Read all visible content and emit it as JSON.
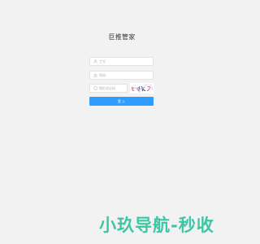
{
  "title": "巨推管家",
  "form": {
    "username": {
      "icon": "user-icon",
      "placeholder": "工号"
    },
    "password": {
      "icon": "lock-icon",
      "placeholder": "密码"
    },
    "captcha": {
      "icon": "shield-icon",
      "placeholder": "图形验证码"
    },
    "login_label": "登 入"
  },
  "watermark": {
    "text": "小玖导航-秒收"
  },
  "colors": {
    "background": "#f2f2f2",
    "accent": "#2e9dff",
    "watermark": "#3cc7a4"
  }
}
